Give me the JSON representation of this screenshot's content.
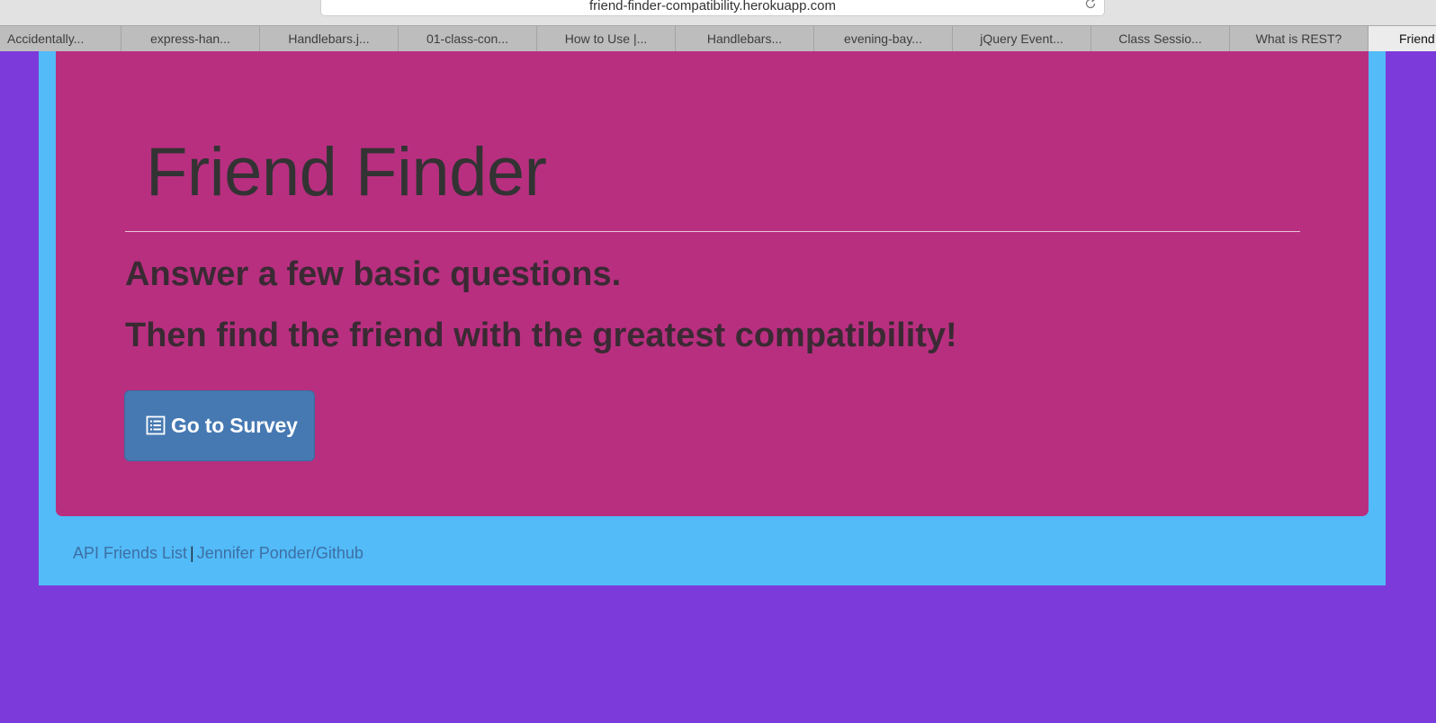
{
  "browser": {
    "url": "friend-finder-compatibility.herokuapp.com",
    "tabs": [
      {
        "label": "Accidentally..."
      },
      {
        "label": "express-han..."
      },
      {
        "label": "Handlebars.j..."
      },
      {
        "label": "01-class-con..."
      },
      {
        "label": "How to Use |..."
      },
      {
        "label": "Handlebars..."
      },
      {
        "label": "evening-bay..."
      },
      {
        "label": "jQuery Event..."
      },
      {
        "label": "Class Sessio..."
      },
      {
        "label": "What is REST?"
      },
      {
        "label": "Friend"
      }
    ],
    "active_tab_index": 10
  },
  "jumbotron": {
    "title": "Friend Finder",
    "lead_1": "Answer a few basic questions.",
    "lead_2": "Then find the friend with the greatest compatibility!",
    "survey_button": {
      "label": "Go to Survey",
      "icon": "list-alt-icon"
    }
  },
  "footer": {
    "api_link": "API Friends List",
    "separator": "|",
    "github_link": "Jennifer Ponder/Github"
  },
  "colors": {
    "page_background": "#7d3adb",
    "container_background": "#52bbf8",
    "jumbotron_background": "#b82f80",
    "button_background": "#4679b2",
    "link_color": "#3d6fa4"
  }
}
